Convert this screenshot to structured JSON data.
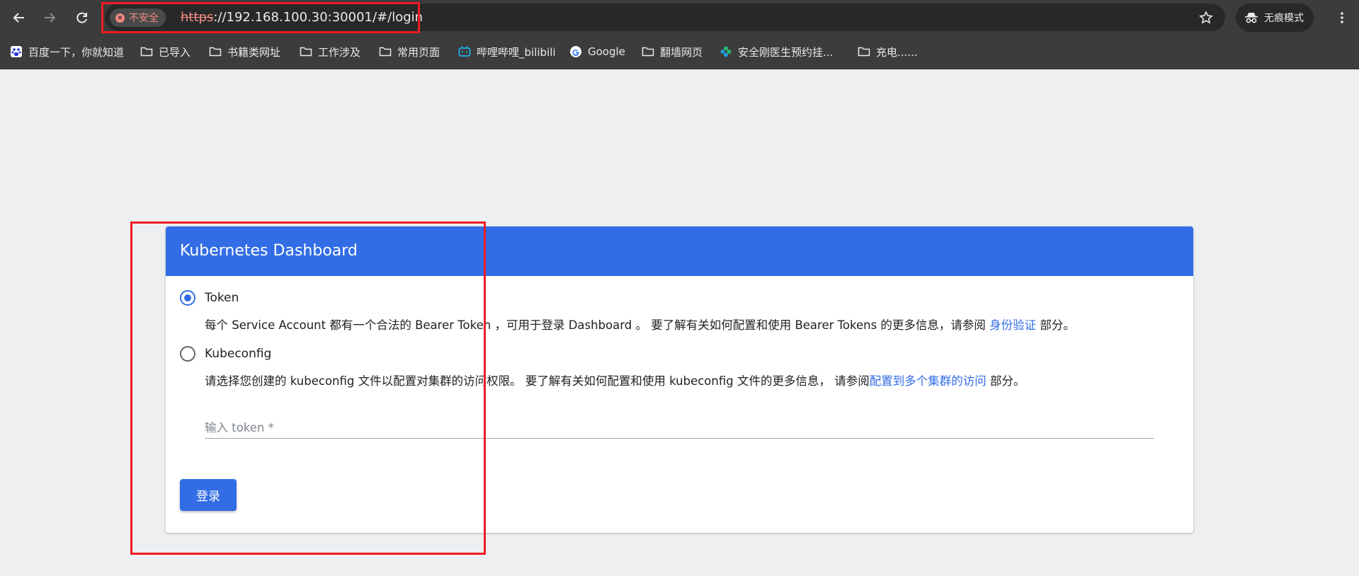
{
  "browser": {
    "security_label": "不安全",
    "url_protocol": "https",
    "url_separator": "://",
    "url_rest": "192.168.100.30:30001/#/login",
    "incognito_label": "无痕模式"
  },
  "bookmarks": [
    {
      "label": "百度一下，你就知道",
      "icon": "baidu-icon"
    },
    {
      "label": "已导入",
      "icon": "folder-icon"
    },
    {
      "label": "书籍类网址",
      "icon": "folder-icon"
    },
    {
      "label": "工作涉及",
      "icon": "folder-icon"
    },
    {
      "label": "常用页面",
      "icon": "folder-icon"
    },
    {
      "label": "哔哩哔哩_bilibili",
      "icon": "bilibili-icon"
    },
    {
      "label": "Google",
      "icon": "google-icon"
    },
    {
      "label": "翻墙网页",
      "icon": "folder-icon"
    },
    {
      "label": "安全刚医生预约挂...",
      "icon": "clover-icon"
    },
    {
      "label": "充电......",
      "icon": "folder-icon"
    }
  ],
  "card": {
    "title": "Kubernetes Dashboard",
    "options": [
      {
        "label": "Token",
        "selected": true,
        "desc_before": "每个 Service Account 都有一个合法的 Bearer Token ，可用于登录 Dashboard 。 要了解有关如何配置和使用 Bearer Tokens 的更多信息，请参阅 ",
        "desc_link": "身份验证",
        "desc_after": " 部分。"
      },
      {
        "label": "Kubeconfig",
        "selected": false,
        "desc_before": "请选择您创建的 kubeconfig 文件以配置对集群的访问权限。 要了解有关如何配置和使用 kubeconfig 文件的更多信息， 请参阅",
        "desc_link": "配置到多个集群的访问",
        "desc_after": " 部分。"
      }
    ],
    "token_placeholder": "输入 token *",
    "login_button": "登录"
  },
  "colors": {
    "primary": "#326de6",
    "annotation": "#ee1c24",
    "warning": "#f28b82"
  }
}
